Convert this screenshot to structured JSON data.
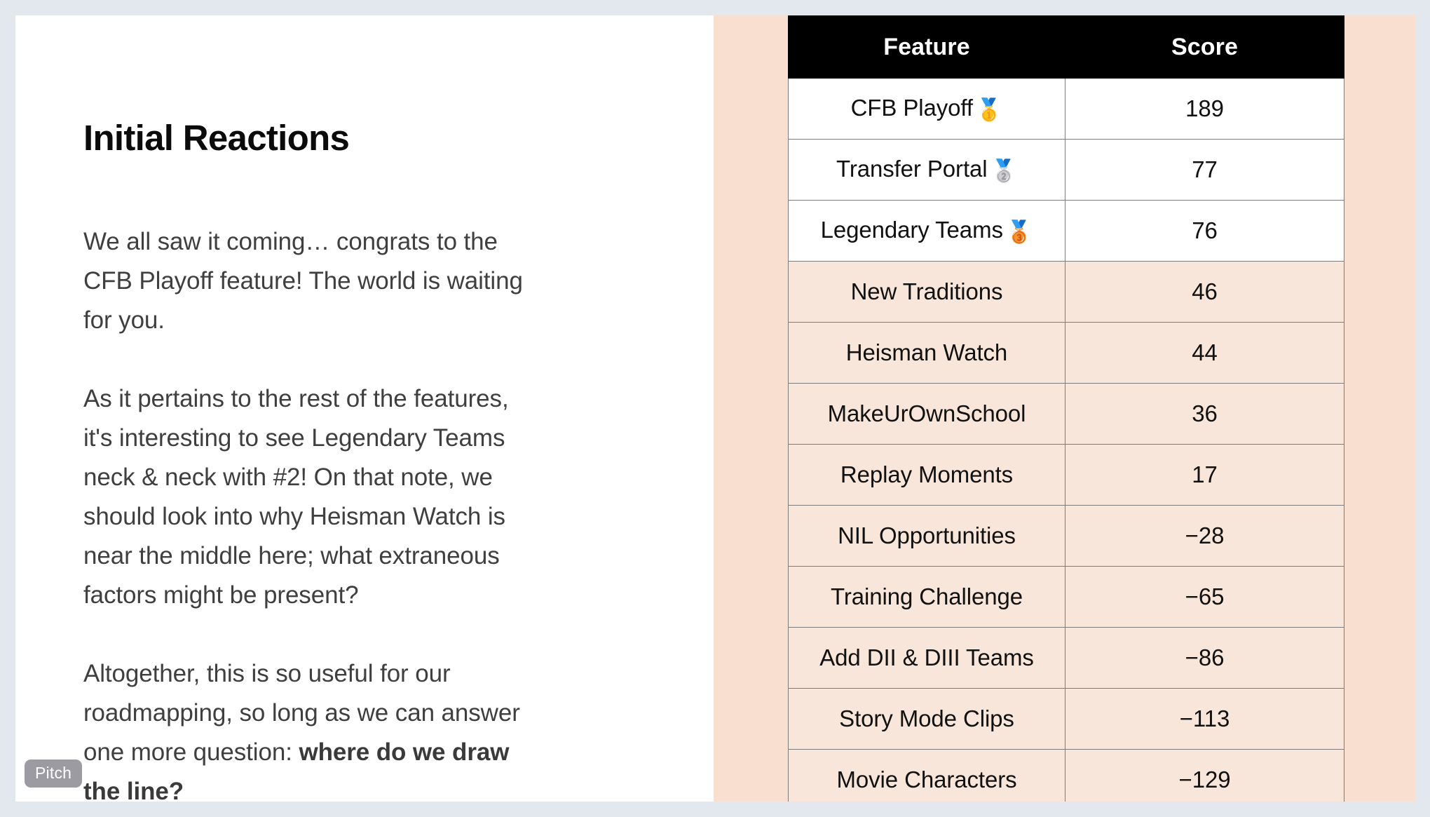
{
  "slide": {
    "title": "Initial Reactions",
    "badge_label": "Pitch",
    "paragraphs": [
      {
        "id": "p1",
        "runs": [
          {
            "text": "We all saw it coming… congrats to the CFB Playoff feature! The world is waiting for you.",
            "bold": false
          }
        ]
      },
      {
        "id": "p2",
        "runs": [
          {
            "text": "As it pertains to the rest of the features, it's interesting to see Legendary Teams neck & neck with #2! On that note, we should look into why Heisman Watch is near the middle here; what extraneous factors might be present?",
            "bold": false
          }
        ]
      },
      {
        "id": "p3",
        "runs": [
          {
            "text": "Altogether, this is so useful for our roadmapping, so long as we can answer one more question: ",
            "bold": false
          },
          {
            "text": "where do we draw the line?",
            "bold": true
          }
        ]
      }
    ]
  },
  "colors": {
    "page_background": "#e3e8ef",
    "slide_background": "#ffffff",
    "accent_panel": "#f9dfd0",
    "table_header_background": "#000000",
    "table_header_text": "#ffffff",
    "row_highlight_background": "#ffffff",
    "row_default_background": "#f9e6da",
    "table_border": "#7c7c7c",
    "body_text": "#3f3f3f",
    "badge_background": "#9b9ba1"
  },
  "chart_data": {
    "type": "table",
    "title": "Feature Score Ranking",
    "columns": [
      "Feature",
      "Score"
    ],
    "categories": [
      "CFB Playoff",
      "Transfer Portal",
      "Legendary Teams",
      "New Traditions",
      "Heisman Watch",
      "MakeUrOwnSchool",
      "Replay Moments",
      "NIL Opportunities",
      "Training Challenge",
      "Add DII & DIII Teams",
      "Story Mode Clips",
      "Movie Characters"
    ],
    "values": [
      189,
      77,
      76,
      46,
      44,
      36,
      17,
      -28,
      -65,
      -86,
      -113,
      -129
    ],
    "xlabel": "Feature",
    "ylabel": "Score",
    "rows": [
      {
        "feature": "CFB Playoff",
        "medal": "🥇",
        "medal_name": "gold-medal-icon",
        "score": "189",
        "highlight": true
      },
      {
        "feature": "Transfer Portal",
        "medal": "🥈",
        "medal_name": "silver-medal-icon",
        "score": "77",
        "highlight": true
      },
      {
        "feature": "Legendary Teams",
        "medal": "🥉",
        "medal_name": "bronze-medal-icon",
        "score": "76",
        "highlight": true
      },
      {
        "feature": "New Traditions",
        "medal": "",
        "medal_name": "",
        "score": "46",
        "highlight": false
      },
      {
        "feature": "Heisman Watch",
        "medal": "",
        "medal_name": "",
        "score": "44",
        "highlight": false
      },
      {
        "feature": "MakeUrOwnSchool",
        "medal": "",
        "medal_name": "",
        "score": "36",
        "highlight": false
      },
      {
        "feature": "Replay Moments",
        "medal": "",
        "medal_name": "",
        "score": "17",
        "highlight": false
      },
      {
        "feature": "NIL Opportunities",
        "medal": "",
        "medal_name": "",
        "score": "−28",
        "highlight": false
      },
      {
        "feature": "Training Challenge",
        "medal": "",
        "medal_name": "",
        "score": "−65",
        "highlight": false
      },
      {
        "feature": "Add DII & DIII Teams",
        "medal": "",
        "medal_name": "",
        "score": "−86",
        "highlight": false
      },
      {
        "feature": "Story Mode Clips",
        "medal": "",
        "medal_name": "",
        "score": "−113",
        "highlight": false
      },
      {
        "feature": "Movie Characters",
        "medal": "",
        "medal_name": "",
        "score": "−129",
        "highlight": false
      }
    ]
  }
}
